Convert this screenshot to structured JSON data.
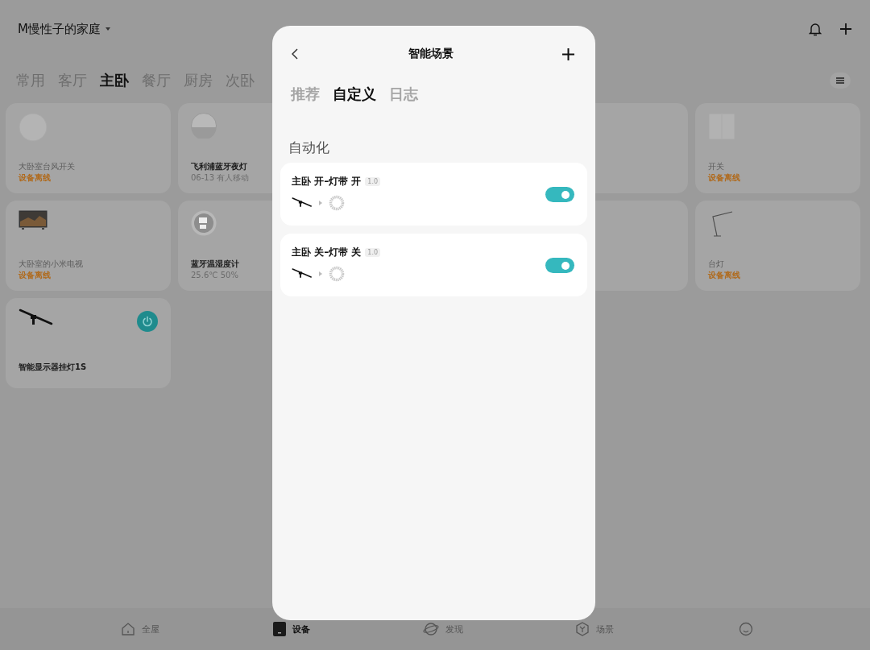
{
  "header": {
    "home_name": "M慢性子的家庭"
  },
  "rooms": [
    {
      "label": "常用",
      "selected": false
    },
    {
      "label": "客厅",
      "selected": false
    },
    {
      "label": "主卧",
      "selected": true
    },
    {
      "label": "餐厅",
      "selected": false
    },
    {
      "label": "厨房",
      "selected": false
    },
    {
      "label": "次卧",
      "selected": false
    }
  ],
  "devices": [
    {
      "kind": "round-switch",
      "name": "大卧室台风开关",
      "status": "设备离线",
      "offline": true
    },
    {
      "kind": "night-light",
      "name": "飞利浦蓝牙夜灯",
      "status": "06-13 有人移动",
      "offline": false
    },
    {
      "kind": "hidden"
    },
    {
      "kind": "square-switch",
      "name": "开关",
      "status": "设备离线",
      "offline": true
    },
    {
      "kind": "tv",
      "name": "大卧室的小米电视",
      "status": "设备离线",
      "offline": true
    },
    {
      "kind": "hygrometer",
      "name": "蓝牙温湿度计",
      "status": "25.6℃ 50%",
      "offline": false
    },
    {
      "kind": "hidden"
    },
    {
      "kind": "desk-lamp",
      "name": "台灯",
      "status": "设备离线",
      "offline": true
    },
    {
      "kind": "light-bar",
      "name": "智能显示器挂灯1S",
      "offline": false,
      "power_on": true
    }
  ],
  "dialog": {
    "title": "智能场景",
    "tabs": [
      {
        "label": "推荐",
        "selected": false
      },
      {
        "label": "自定义",
        "selected": true
      },
      {
        "label": "日志",
        "selected": false
      }
    ],
    "section": "自动化",
    "scenes": [
      {
        "name": "主卧 开–灯带 开",
        "version": "1.0",
        "enabled": true
      },
      {
        "name": "主卧 关–灯带 关",
        "version": "1.0",
        "enabled": true
      }
    ]
  },
  "nav": [
    {
      "kind": "house",
      "label": "全屋",
      "selected": false
    },
    {
      "kind": "device",
      "label": "设备",
      "selected": true
    },
    {
      "kind": "planet",
      "label": "发现",
      "selected": false
    },
    {
      "kind": "hexagon",
      "label": "场景",
      "selected": false
    },
    {
      "kind": "smile"
    }
  ]
}
